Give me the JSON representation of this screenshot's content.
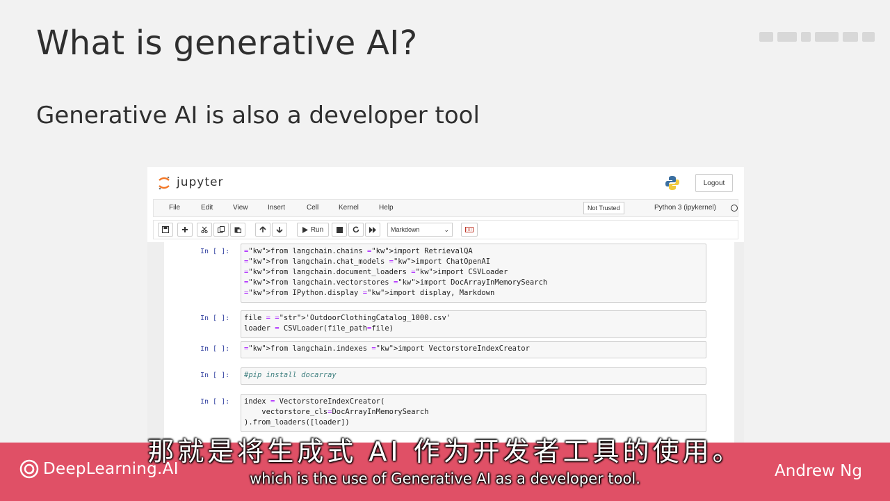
{
  "slide": {
    "title": "What is generative AI?",
    "subtitle": "Generative AI is also a developer tool"
  },
  "jupyter": {
    "brand": "jupyter",
    "logout_label": "Logout",
    "menu": [
      "File",
      "Edit",
      "View",
      "Insert",
      "Cell",
      "Kernel",
      "Help"
    ],
    "trust_label": "Not Trusted",
    "kernel_label": "Python 3 (ipykernel)",
    "toolbar": {
      "run_label": "Run",
      "cell_type": "Markdown",
      "icons": [
        "save-icon",
        "add-icon",
        "cut-icon",
        "copy-icon",
        "paste-icon",
        "move-up-icon",
        "move-down-icon",
        "run-icon",
        "stop-icon",
        "restart-icon",
        "fast-forward-icon",
        "keyboard-icon"
      ]
    },
    "cells": [
      {
        "prompt": "In [ ]:",
        "lines": [
          "from langchain.chains import RetrievalQA",
          "from langchain.chat_models import ChatOpenAI",
          "from langchain.document_loaders import CSVLoader",
          "from langchain.vectorstores import DocArrayInMemorySearch",
          "from IPython.display import display, Markdown"
        ]
      },
      {
        "prompt": "In [ ]:",
        "lines": [
          "file = 'OutdoorClothingCatalog_1000.csv'",
          "loader = CSVLoader(file_path=file)"
        ]
      },
      {
        "prompt": "In [ ]:",
        "lines": [
          "from langchain.indexes import VectorstoreIndexCreator"
        ]
      },
      {
        "prompt": "In [ ]:",
        "lines": [
          "#pip install docarray"
        ]
      },
      {
        "prompt": "In [ ]:",
        "lines": [
          "index = VectorstoreIndexCreator(",
          "    vectorstore_cls=DocArrayInMemorySearch",
          ").from_loaders([loader])"
        ]
      }
    ]
  },
  "footer": {
    "brand": "DeepLearning.AI",
    "presenter": "Andrew Ng",
    "accent_color": "#e05066"
  },
  "subtitles": {
    "zh": "那就是将生成式 AI 作为开发者工具的使用。",
    "en": "which is the use of Generative AI as a developer tool."
  }
}
